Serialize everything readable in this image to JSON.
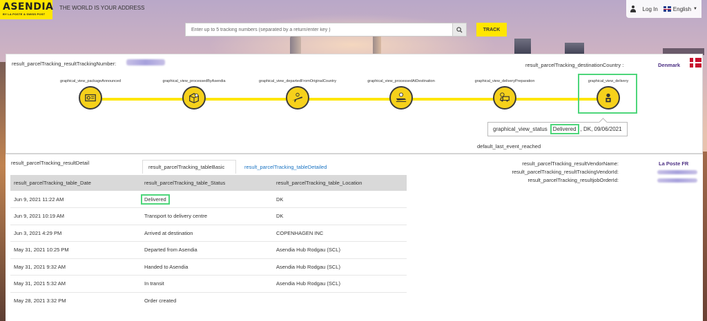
{
  "header": {
    "logo_text": "ASENDIA",
    "logo_sub": "BY LA POSTE & SWISS POST",
    "tagline": "THE WORLD IS YOUR ADDRESS",
    "login": "Log In",
    "language": "English"
  },
  "search": {
    "placeholder": "Enter up to 5 tracking numbers (separated by a return/enter key )",
    "track_label": "TRACK"
  },
  "tracking": {
    "number_label": "result_parcelTracking_resultTrackingNumber:",
    "destination_label": "result_parcelTracking_destinationCountry :",
    "destination_value": "Denmark"
  },
  "steps": [
    {
      "label": "graphical_view_packageAnnounced",
      "icon": "package-announced-icon"
    },
    {
      "label": "graphical_view_processedByAsendia",
      "icon": "box-processed-icon"
    },
    {
      "label": "graphical_view_departedFromOriginalCountry",
      "icon": "airplane-departure-icon"
    },
    {
      "label": "graphical_view_processedAtDestination",
      "icon": "airplane-landing-icon"
    },
    {
      "label": "graphical_view_deliveryPreparation",
      "icon": "delivery-truck-icon"
    },
    {
      "label": "graphical_view_delivery",
      "icon": "courier-icon"
    }
  ],
  "status": {
    "label": "graphical_view_status",
    "value": "Delivered",
    "rest": ", DK, 09/06/2021",
    "last_event": "default_last_event_reached"
  },
  "details": {
    "result_detail": "result_parcelTracking_resultDetail",
    "tab_basic": "result_parcelTracking_tableBasic",
    "tab_detailed": "result_parcelTracking_tableDetailed",
    "columns": [
      "result_parcelTracking_table_Date",
      "result_parcelTracking_table_Status",
      "result_parcelTracking_table_Location"
    ],
    "rows": [
      [
        "Jun 9, 2021 11:22 AM",
        "Delivered",
        "DK"
      ],
      [
        "Jun 9, 2021 10:19 AM",
        "Transport to delivery centre",
        "DK"
      ],
      [
        "Jun 3, 2021 4:29 PM",
        "Arrived at destination",
        "COPENHAGEN INC"
      ],
      [
        "May 31, 2021 10:25 PM",
        "Departed from Asendia",
        "Asendia Hub Rodgau (SCL)"
      ],
      [
        "May 31, 2021 9:32 AM",
        "Handed to Asendia",
        "Asendia Hub Rodgau (SCL)"
      ],
      [
        "May 31, 2021 5:32 AM",
        "In transit",
        "Asendia Hub Rodgau (SCL)"
      ],
      [
        "May 28, 2021 3:32 PM",
        "Order created",
        ""
      ]
    ]
  },
  "vendor": {
    "name_label": "result_parcelTracking_resultVendorName:",
    "name_value": "La Poste FR",
    "tracking_vendor_label": "result_parcelTracking_resultTrackingVendorId:",
    "job_order_label": "result_parcelTracking_resultjobOrderId:"
  },
  "colors": {
    "brand_yellow": "#ffe600",
    "highlight_green": "#4dd67a",
    "link_blue": "#1b74c3",
    "vendor_purple": "#4b2e83"
  }
}
